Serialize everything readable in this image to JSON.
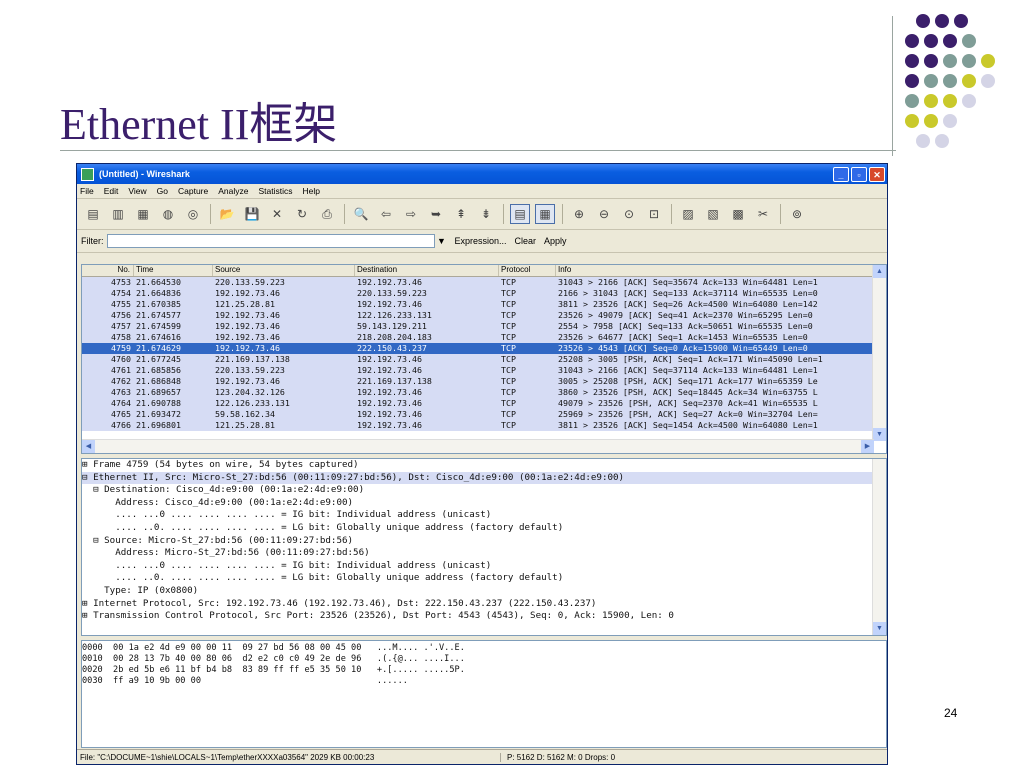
{
  "slide": {
    "title": "Ethernet II框架",
    "page_number": "24"
  },
  "decor": {
    "colors": [
      "#3b1f6b",
      "#7f9d97",
      "#c9c92b",
      "#d4d4e6"
    ]
  },
  "window": {
    "title": "(Untitled) - Wireshark",
    "buttons": {
      "minimize": "_",
      "maximize": "▫",
      "close": "✕"
    }
  },
  "menu": [
    "File",
    "Edit",
    "View",
    "Go",
    "Capture",
    "Analyze",
    "Statistics",
    "Help"
  ],
  "filter": {
    "label": "Filter:",
    "value": "",
    "expression_label": "Expression...",
    "clear_label": "Clear",
    "apply_label": "Apply"
  },
  "packet_list": {
    "columns": [
      "No.",
      "Time",
      "Source",
      "Destination",
      "Protocol",
      "Info"
    ],
    "rows": [
      [
        "4753",
        "21.664530",
        "220.133.59.223",
        "192.192.73.46",
        "TCP",
        "31043 > 2166 [ACK] Seq=35674 Ack=133 Win=64481 Len=1"
      ],
      [
        "4754",
        "21.664836",
        "192.192.73.46",
        "220.133.59.223",
        "TCP",
        "2166 > 31043 [ACK] Seq=133 Ack=37114 Win=65535 Len=0"
      ],
      [
        "4755",
        "21.670385",
        "121.25.28.81",
        "192.192.73.46",
        "TCP",
        "3811 > 23526 [ACK] Seq=26 Ack=4500 Win=64080 Len=142"
      ],
      [
        "4756",
        "21.674577",
        "192.192.73.46",
        "122.126.233.131",
        "TCP",
        "23526 > 49079 [ACK] Seq=41 Ack=2370 Win=65295 Len=0"
      ],
      [
        "4757",
        "21.674599",
        "192.192.73.46",
        "59.143.129.211",
        "TCP",
        "2554 > 7958 [ACK] Seq=133 Ack=50651 Win=65535 Len=0"
      ],
      [
        "4758",
        "21.674616",
        "192.192.73.46",
        "218.208.204.183",
        "TCP",
        "23526 > 64677 [ACK] Seq=1 Ack=1453 Win=65535 Len=0"
      ],
      [
        "4759",
        "21.674629",
        "192.192.73.46",
        "222.150.43.237",
        "TCP",
        "23526 > 4543 [ACK] Seq=0 Ack=15900 Win=65449 Len=0"
      ],
      [
        "4760",
        "21.677245",
        "221.169.137.138",
        "192.192.73.46",
        "TCP",
        "25208 > 3005 [PSH, ACK] Seq=1 Ack=171 Win=45090 Len=1"
      ],
      [
        "4761",
        "21.685856",
        "220.133.59.223",
        "192.192.73.46",
        "TCP",
        "31043 > 2166 [ACK] Seq=37114 Ack=133 Win=64481 Len=1"
      ],
      [
        "4762",
        "21.686848",
        "192.192.73.46",
        "221.169.137.138",
        "TCP",
        "3005 > 25208 [PSH, ACK] Seq=171 Ack=177 Win=65359 Le"
      ],
      [
        "4763",
        "21.689657",
        "123.204.32.126",
        "192.192.73.46",
        "TCP",
        "3860 > 23526 [PSH, ACK] Seq=18445 Ack=34 Win=63755 L"
      ],
      [
        "4764",
        "21.690788",
        "122.126.233.131",
        "192.192.73.46",
        "TCP",
        "49079 > 23526 [PSH, ACK] Seq=2370 Ack=41 Win=65535 L"
      ],
      [
        "4765",
        "21.693472",
        "59.58.162.34",
        "192.192.73.46",
        "TCP",
        "25969 > 23526 [PSH, ACK] Seq=27 Ack=0 Win=32704 Len="
      ],
      [
        "4766",
        "21.696801",
        "121.25.28.81",
        "192.192.73.46",
        "TCP",
        "3811 > 23526 [ACK] Seq=1454 Ack=4500 Win=64080 Len=1"
      ]
    ],
    "selected_no": "4759"
  },
  "details": [
    "⊞ Frame 4759 (54 bytes on wire, 54 bytes captured)",
    "⊟ Ethernet II, Src: Micro-St_27:bd:56 (00:11:09:27:bd:56), Dst: Cisco_4d:e9:00 (00:1a:e2:4d:e9:00)",
    "  ⊟ Destination: Cisco_4d:e9:00 (00:1a:e2:4d:e9:00)",
    "      Address: Cisco_4d:e9:00 (00:1a:e2:4d:e9:00)",
    "      .... ...0 .... .... .... .... = IG bit: Individual address (unicast)",
    "      .... ..0. .... .... .... .... = LG bit: Globally unique address (factory default)",
    "  ⊟ Source: Micro-St_27:bd:56 (00:11:09:27:bd:56)",
    "      Address: Micro-St_27:bd:56 (00:11:09:27:bd:56)",
    "      .... ...0 .... .... .... .... = IG bit: Individual address (unicast)",
    "      .... ..0. .... .... .... .... = LG bit: Globally unique address (factory default)",
    "    Type: IP (0x0800)",
    "⊞ Internet Protocol, Src: 192.192.73.46 (192.192.73.46), Dst: 222.150.43.237 (222.150.43.237)",
    "⊞ Transmission Control Protocol, Src Port: 23526 (23526), Dst Port: 4543 (4543), Seq: 0, Ack: 15900, Len: 0"
  ],
  "hex": [
    "0000  00 1a e2 4d e9 00 00 11  09 27 bd 56 08 00 45 00   ...M.... .'.V..E.",
    "0010  00 28 13 7b 40 00 80 06  d2 e2 c0 c0 49 2e de 96   .(.{@... ....I...",
    "0020  2b ed 5b e6 11 bf b4 b8  83 89 ff ff e5 35 50 10   +.[..... .....5P.",
    "0030  ff a9 10 9b 00 00                                  ......"
  ],
  "status": {
    "file": "File: \"C:\\DOCUME~1\\shie\\LOCALS~1\\Temp\\etherXXXXa03564\" 2029 KB 00:00:23",
    "packets": "P: 5162 D: 5162 M: 0 Drops: 0"
  },
  "toolbar_icons": [
    "list-interfaces-icon",
    "capture-options-icon",
    "start-capture-icon",
    "stop-capture-icon",
    "restart-capture-icon",
    "open-icon",
    "save-icon",
    "close-file-icon",
    "reload-icon",
    "print-icon",
    "find-icon",
    "back-icon",
    "forward-icon",
    "goto-icon",
    "first-icon",
    "last-icon",
    "colorize-icon",
    "autoscroll-icon",
    "zoom-in-icon",
    "zoom-out-icon",
    "zoom-normal-icon",
    "resize-columns-icon",
    "capture-filters-icon",
    "display-filters-icon",
    "coloring-rules-icon",
    "preferences-icon",
    "help-icon"
  ]
}
